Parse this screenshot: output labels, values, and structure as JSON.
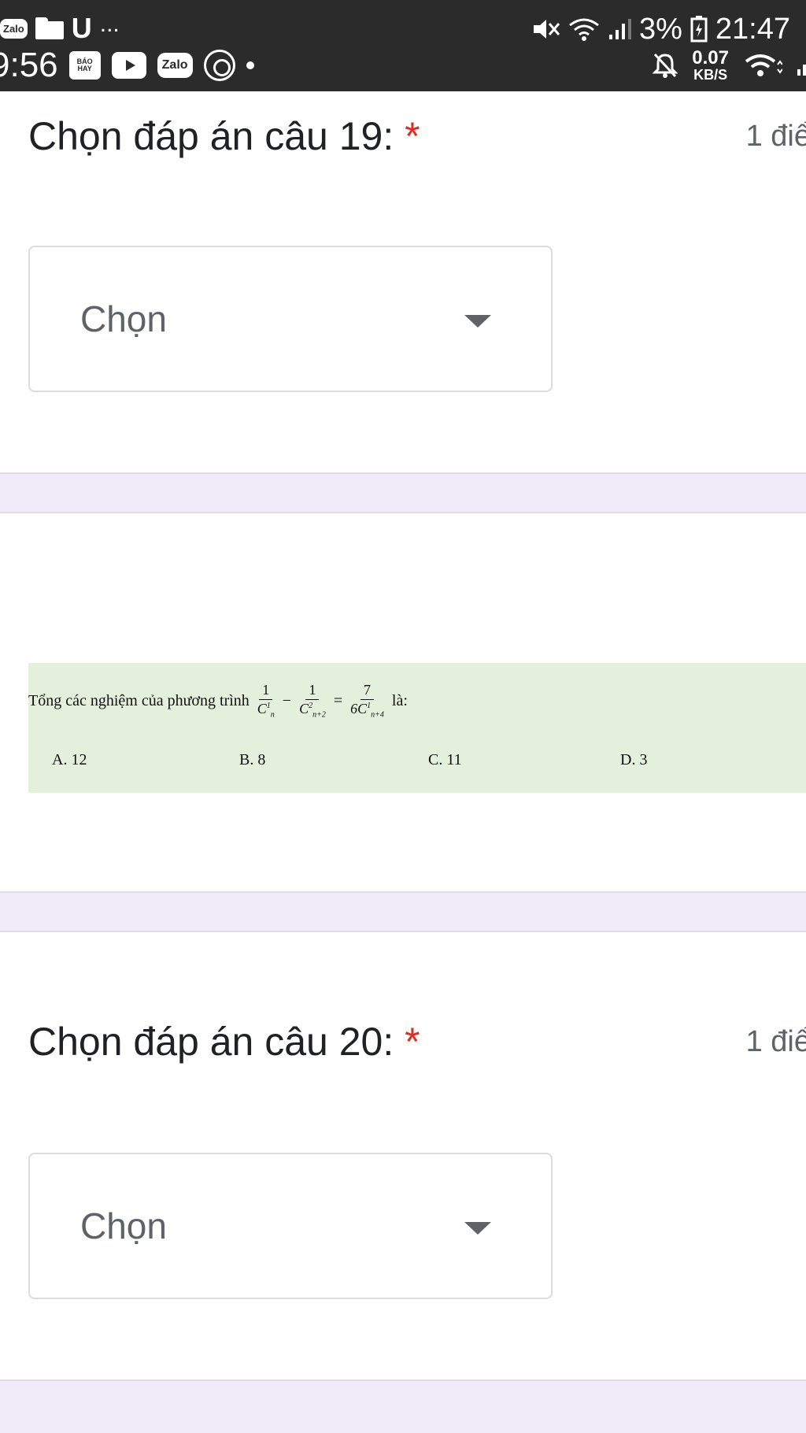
{
  "status_bar": {
    "left_top": {
      "app1": "Zalo",
      "u_glyph": "U",
      "more": "..."
    },
    "left_bottom": {
      "time": "9:56",
      "news_label": "BÁO HAY",
      "app2": "Zalo"
    },
    "right_top": {
      "battery_pct": "3%",
      "time": "21:47"
    },
    "right_bottom": {
      "speed_value": "0.07",
      "speed_unit": "KB/S"
    },
    "icons": [
      "zalo-icon",
      "folder-icon",
      "news-icon",
      "youtube-icon",
      "zalo-icon",
      "steering-wheel-icon",
      "mute-icon",
      "wifi-icon",
      "signal-icon",
      "battery-icon",
      "bell-off-icon"
    ]
  },
  "q19": {
    "title": "Chọn đáp án câu 19:",
    "required_mark": "*",
    "points": "1 điể",
    "select_label": "Chọn"
  },
  "problem": {
    "stem": "Tổng các nghiệm của phương trình",
    "frac1_num": "1",
    "frac1_den": "C",
    "frac1_sup": "1",
    "frac1_sub": "n",
    "minus": "−",
    "frac2_num": "1",
    "frac2_den": "C",
    "frac2_sup": "2",
    "frac2_sub": "n+2",
    "equals": "=",
    "frac3_num": "7",
    "frac3_den": "6C",
    "frac3_sup": "1",
    "frac3_sub": "n+4",
    "suffix": "là:",
    "options": {
      "a": "A. 12",
      "b": "B. 8",
      "c": "C. 11",
      "d": "D. 3"
    },
    "background": "#e4f0dc"
  },
  "q20": {
    "title": "Chọn đáp án câu 20:",
    "required_mark": "*",
    "points": "1 điể",
    "select_label": "Chọn"
  },
  "colors": {
    "required": "#d93025",
    "separator": "#f0ebf8",
    "statusbar": "#2b2b2b"
  }
}
